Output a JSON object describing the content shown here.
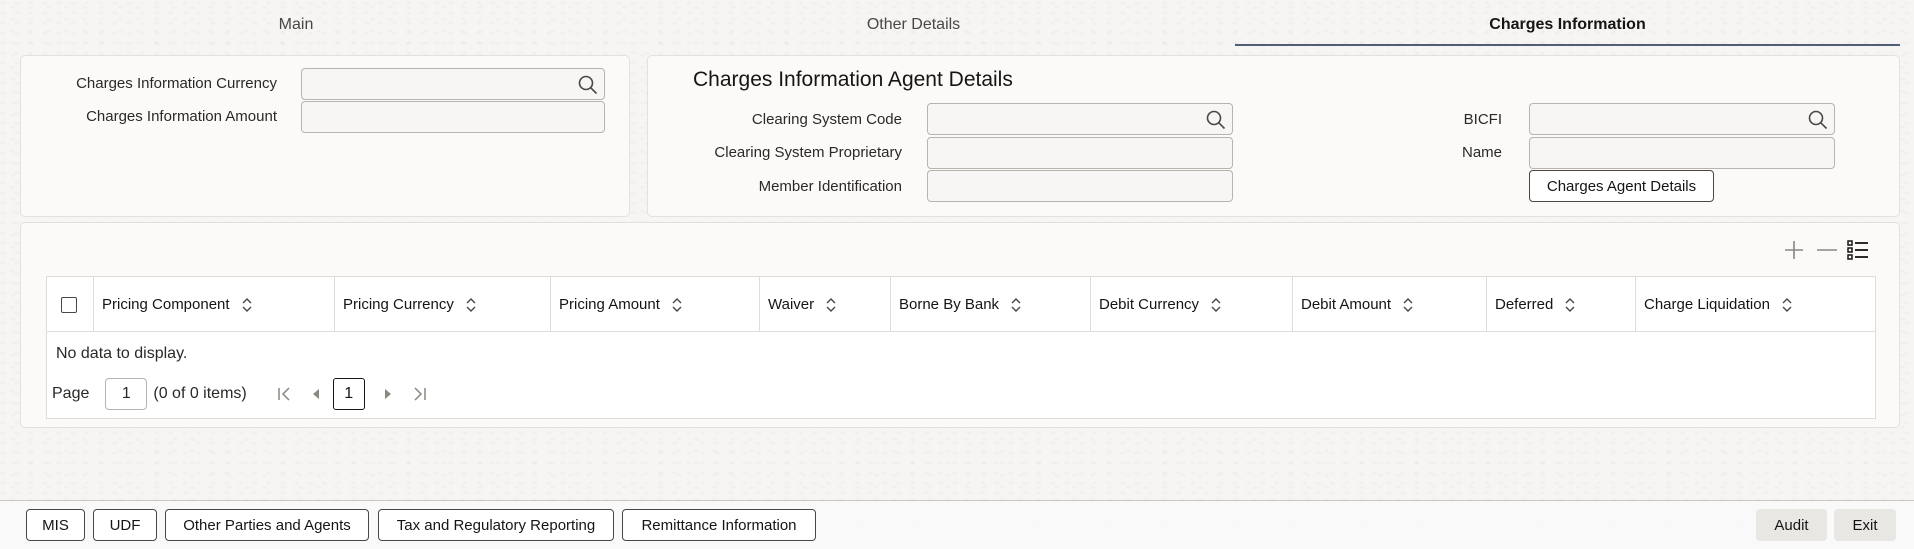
{
  "tabs": [
    {
      "label": "Main"
    },
    {
      "label": "Other Details"
    },
    {
      "label": "Charges Information"
    }
  ],
  "charges_info": {
    "currency_label": "Charges Information Currency",
    "amount_label": "Charges Information Amount",
    "currency_value": "",
    "amount_value": ""
  },
  "agent": {
    "title": "Charges Information Agent Details",
    "clearing_code_label": "Clearing System Code",
    "clearing_prop_label": "Clearing System Proprietary",
    "member_id_label": "Member Identification",
    "bicfi_label": "BICFI",
    "name_label": "Name",
    "details_button": "Charges Agent Details"
  },
  "grid": {
    "columns": [
      "Pricing Component",
      "Pricing Currency",
      "Pricing Amount",
      "Waiver",
      "Borne By Bank",
      "Debit Currency",
      "Debit Amount",
      "Deferred",
      "Charge Liquidation"
    ],
    "no_data": "No data to display.",
    "page_label": "Page",
    "page_value": "1",
    "items_text": "(0 of 0 items)",
    "current_page": "1"
  },
  "footer": {
    "buttons": [
      "MIS",
      "UDF",
      "Other Parties and Agents",
      "Tax and Regulatory Reporting",
      "Remittance Information"
    ],
    "audit": "Audit",
    "exit": "Exit"
  },
  "icons": [
    "search-icon",
    "add-icon",
    "remove-icon",
    "column-list-icon",
    "sort-icon",
    "first-page-icon",
    "previous-page-icon",
    "next-page-icon",
    "last-page-icon"
  ]
}
